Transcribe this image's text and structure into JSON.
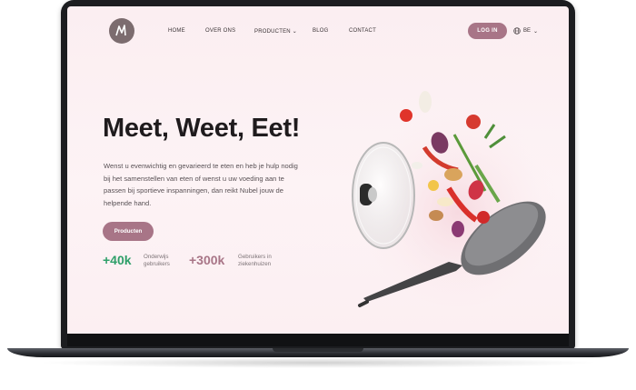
{
  "nav": {
    "items": [
      {
        "label": "HOME"
      },
      {
        "label": "OVER ONS"
      },
      {
        "label": "PRODUCTEN"
      },
      {
        "label": "BLOG"
      },
      {
        "label": "CONTACT"
      }
    ],
    "login_label": "LOG IN",
    "language": "BE",
    "icons": {
      "globe": "globe-icon",
      "chevron": "chevron-down-icon",
      "logo": "nubel-logo"
    }
  },
  "hero": {
    "title": "Meet, Weet, Eet!",
    "body": "Wenst u evenwichtig en gevarieerd te eten en heb je hulp nodig bij het samenstellen van eten of wenst u uw voeding aan te passen bij sportieve inspanningen, dan reikt Nubel jouw de helpende hand.",
    "cta_label": "Producten"
  },
  "stats": [
    {
      "value": "+40k",
      "label_line1": "Onderwijs",
      "label_line2": "gebruikers",
      "color": "#2e9f69"
    },
    {
      "value": "+300k",
      "label_line1": "Gebruikers in",
      "label_line2": "ziekenhuizen",
      "color": "#a87587"
    }
  ],
  "colors": {
    "accent": "#a87587",
    "green": "#2e9f69",
    "screen_bg": "#fbeef1"
  }
}
